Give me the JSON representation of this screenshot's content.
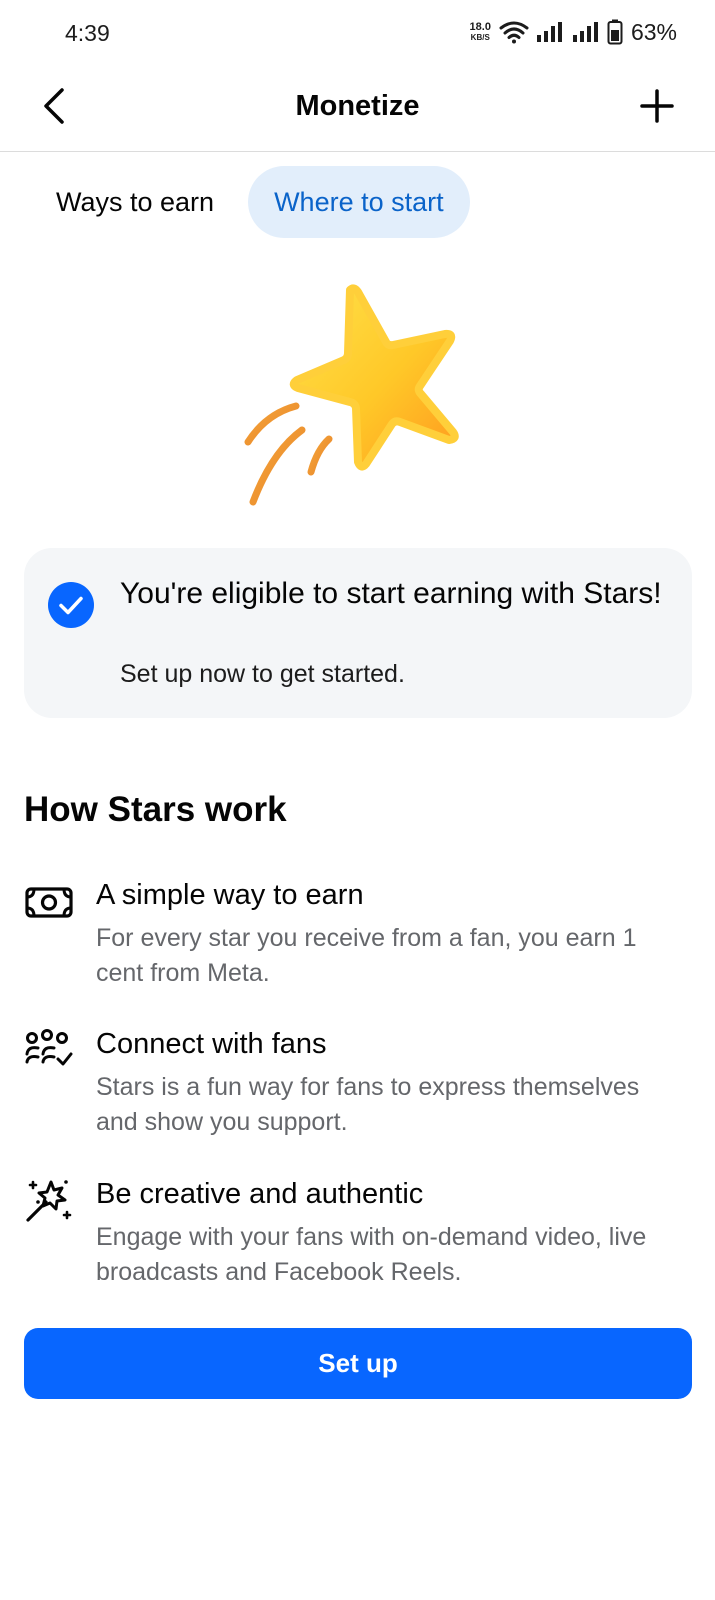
{
  "status_bar": {
    "time": "4:39",
    "net_speed_value": "18.0",
    "net_speed_unit": "KB/S",
    "battery_percent": "63%",
    "icons": [
      "wifi-icon",
      "signal-icon",
      "signal-icon",
      "battery-icon"
    ]
  },
  "header": {
    "title": "Monetize",
    "back_icon": "back-arrow-icon",
    "add_icon": "plus-icon"
  },
  "tabs": [
    {
      "label": "Ways to earn",
      "active": false
    },
    {
      "label": "Where to start",
      "active": true
    }
  ],
  "eligibility": {
    "title": "You're eligible to start earning with Stars!",
    "subtitle": "Set up now to get started.",
    "icon": "check-circle-icon"
  },
  "how_it_works": {
    "title": "How Stars work",
    "features": [
      {
        "icon": "money-icon",
        "title": "A simple way to earn",
        "description": "For every star you receive from a fan, you earn 1 cent from Meta."
      },
      {
        "icon": "fans-icon",
        "title": "Connect with fans",
        "description": "Stars is a fun way for fans to express themselves and show you support."
      },
      {
        "icon": "magic-wand-icon",
        "title": "Be creative and authentic",
        "description": "Engage with your fans with on-demand video, live broadcasts and Facebook Reels."
      }
    ]
  },
  "cta": {
    "label": "Set up"
  },
  "colors": {
    "primary": "#0866ff",
    "tab_active_bg": "#e2eefb",
    "tab_active_text": "#0a63c9",
    "card_bg": "#f4f6f8",
    "secondary_text": "#65676b"
  }
}
